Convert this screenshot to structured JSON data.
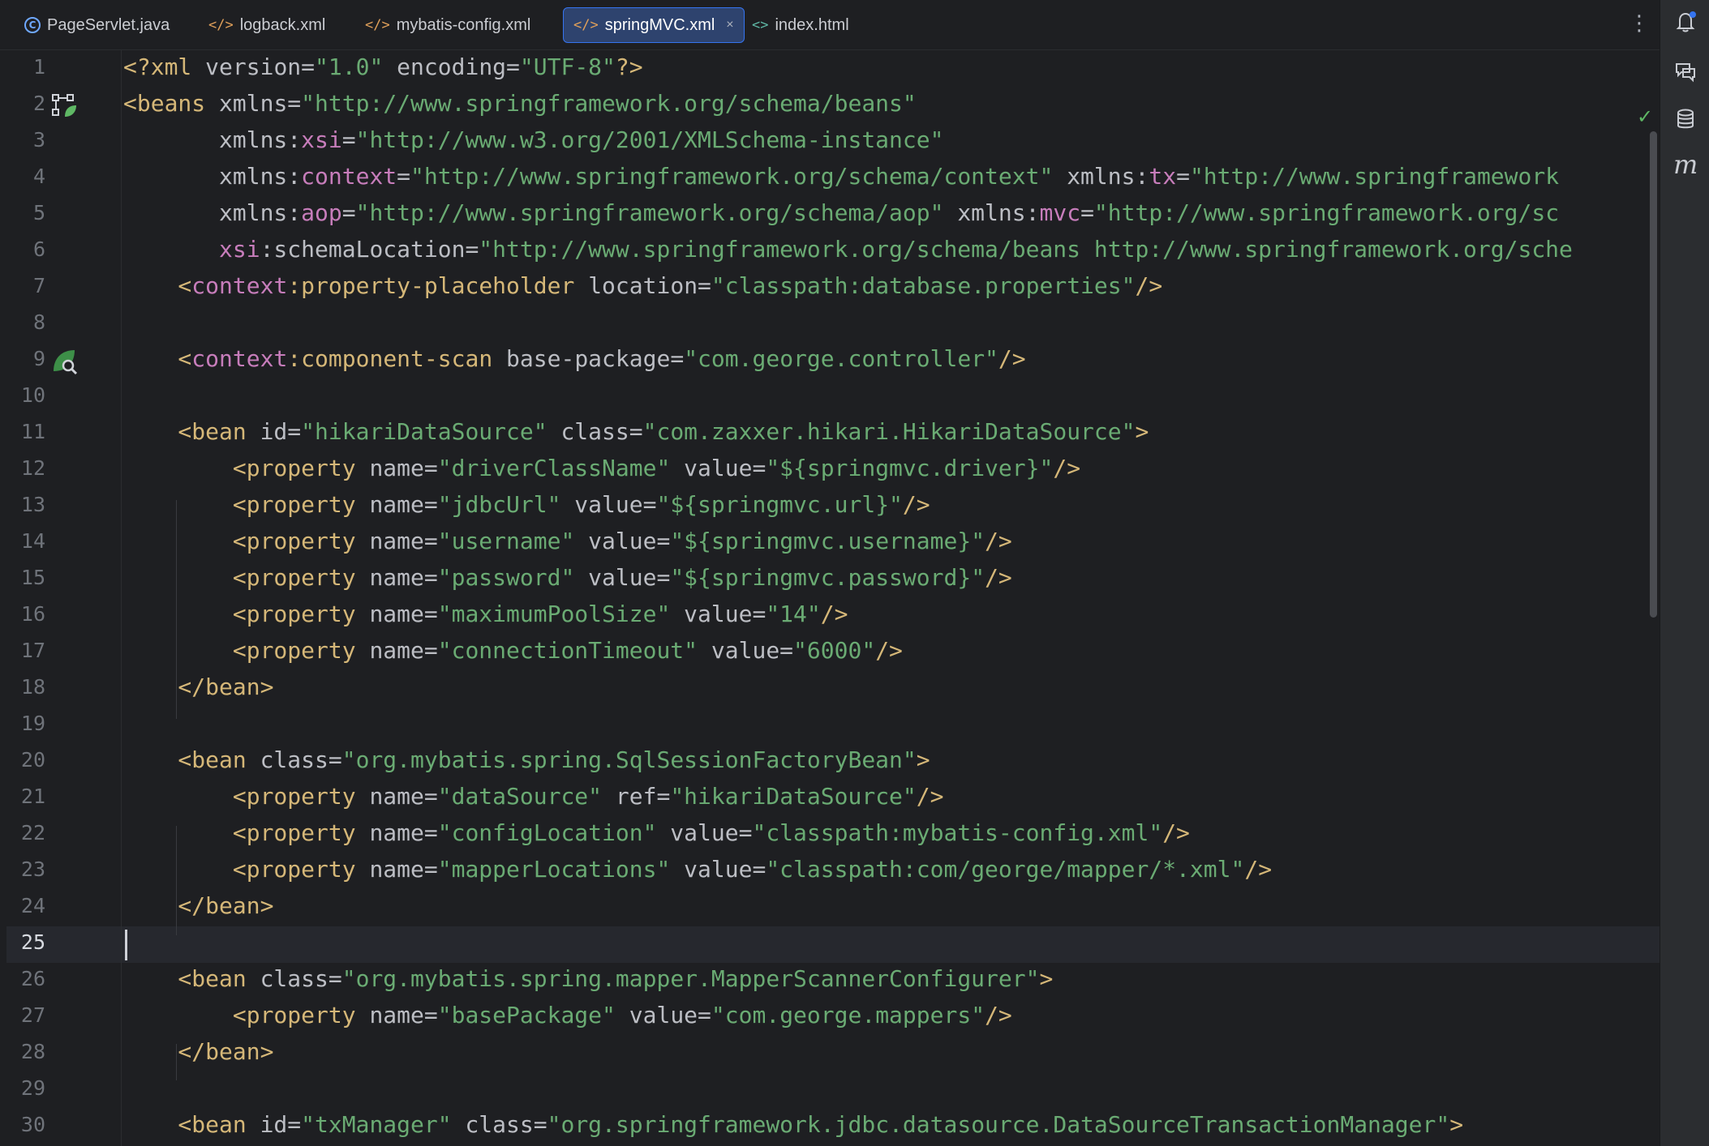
{
  "tabs": [
    {
      "label": "PageServlet.java",
      "icon": "java-class-icon",
      "active": false
    },
    {
      "label": "logback.xml",
      "icon": "xml-icon",
      "active": false
    },
    {
      "label": "mybatis-config.xml",
      "icon": "xml-icon",
      "active": false
    },
    {
      "label": "springMVC.xml",
      "icon": "xml-icon",
      "active": true
    },
    {
      "label": "index.html",
      "icon": "html-icon",
      "active": false
    }
  ],
  "tab_menu_glyph": "⋮",
  "tab_close_glyph": "×",
  "current_line": 25,
  "line_numbers": [
    "1",
    "2",
    "3",
    "4",
    "5",
    "6",
    "7",
    "8",
    "9",
    "10",
    "11",
    "12",
    "13",
    "14",
    "15",
    "16",
    "17",
    "18",
    "19",
    "20",
    "21",
    "22",
    "23",
    "24",
    "25",
    "26",
    "27",
    "28",
    "29",
    "30"
  ],
  "code_lines": [
    [
      [
        "t",
        "<?xml "
      ],
      [
        "a",
        "version="
      ],
      [
        "s",
        "\"1.0\""
      ],
      [
        "a",
        " encoding="
      ],
      [
        "s",
        "\"UTF-8\""
      ],
      [
        "t",
        "?>"
      ]
    ],
    [
      [
        "t",
        "<beans "
      ],
      [
        "a",
        "xmlns="
      ],
      [
        "s",
        "\"http://www.springframework.org/schema/beans\""
      ]
    ],
    [
      [
        "a",
        "       xmlns:"
      ],
      [
        "p",
        "xsi"
      ],
      [
        "a",
        "="
      ],
      [
        "s",
        "\"http://www.w3.org/2001/XMLSchema-instance\""
      ]
    ],
    [
      [
        "a",
        "       xmlns:"
      ],
      [
        "p",
        "context"
      ],
      [
        "a",
        "="
      ],
      [
        "s",
        "\"http://www.springframework.org/schema/context\""
      ],
      [
        "a",
        " xmlns:"
      ],
      [
        "p",
        "tx"
      ],
      [
        "a",
        "="
      ],
      [
        "s",
        "\"http://www.springframework"
      ]
    ],
    [
      [
        "a",
        "       xmlns:"
      ],
      [
        "p",
        "aop"
      ],
      [
        "a",
        "="
      ],
      [
        "s",
        "\"http://www.springframework.org/schema/aop\""
      ],
      [
        "a",
        " xmlns:"
      ],
      [
        "p",
        "mvc"
      ],
      [
        "a",
        "="
      ],
      [
        "s",
        "\"http://www.springframework.org/sc"
      ]
    ],
    [
      [
        "p",
        "       xsi"
      ],
      [
        "a",
        ":schemaLocation="
      ],
      [
        "s",
        "\"http://www.springframework.org/schema/beans http://www.springframework.org/sche"
      ]
    ],
    [
      [
        "t",
        "    <"
      ],
      [
        "p",
        "context"
      ],
      [
        "t",
        ":property-placeholder "
      ],
      [
        "a",
        "location="
      ],
      [
        "s",
        "\"classpath:database.properties\""
      ],
      [
        "t",
        "/>"
      ]
    ],
    [],
    [
      [
        "t",
        "    <"
      ],
      [
        "p",
        "context"
      ],
      [
        "t",
        ":component-scan "
      ],
      [
        "a",
        "base-package="
      ],
      [
        "s",
        "\"com.george.controller\""
      ],
      [
        "t",
        "/>"
      ]
    ],
    [],
    [
      [
        "t",
        "    <bean "
      ],
      [
        "a",
        "id="
      ],
      [
        "s",
        "\"hikariDataSource\""
      ],
      [
        "a",
        " class="
      ],
      [
        "s",
        "\"com.zaxxer.hikari.HikariDataSource\""
      ],
      [
        "t",
        ">"
      ]
    ],
    [
      [
        "t",
        "        <property "
      ],
      [
        "a",
        "name="
      ],
      [
        "s",
        "\"driverClassName\""
      ],
      [
        "a",
        " value="
      ],
      [
        "s",
        "\"${springmvc.driver}\""
      ],
      [
        "t",
        "/>"
      ]
    ],
    [
      [
        "t",
        "        <property "
      ],
      [
        "a",
        "name="
      ],
      [
        "s",
        "\"jdbcUrl\""
      ],
      [
        "a",
        " value="
      ],
      [
        "s",
        "\"${springmvc.url}\""
      ],
      [
        "t",
        "/>"
      ]
    ],
    [
      [
        "t",
        "        <property "
      ],
      [
        "a",
        "name="
      ],
      [
        "s",
        "\"username\""
      ],
      [
        "a",
        " value="
      ],
      [
        "s",
        "\"${springmvc.username}\""
      ],
      [
        "t",
        "/>"
      ]
    ],
    [
      [
        "t",
        "        <property "
      ],
      [
        "a",
        "name="
      ],
      [
        "s",
        "\"password\""
      ],
      [
        "a",
        " value="
      ],
      [
        "s",
        "\"${springmvc.password}\""
      ],
      [
        "t",
        "/>"
      ]
    ],
    [
      [
        "t",
        "        <property "
      ],
      [
        "a",
        "name="
      ],
      [
        "s",
        "\"maximumPoolSize\""
      ],
      [
        "a",
        " value="
      ],
      [
        "s",
        "\"14\""
      ],
      [
        "t",
        "/>"
      ]
    ],
    [
      [
        "t",
        "        <property "
      ],
      [
        "a",
        "name="
      ],
      [
        "s",
        "\"connectionTimeout\""
      ],
      [
        "a",
        " value="
      ],
      [
        "s",
        "\"6000\""
      ],
      [
        "t",
        "/>"
      ]
    ],
    [
      [
        "t",
        "    </bean>"
      ]
    ],
    [],
    [
      [
        "t",
        "    <bean "
      ],
      [
        "a",
        "class="
      ],
      [
        "s",
        "\"org.mybatis.spring.SqlSessionFactoryBean\""
      ],
      [
        "t",
        ">"
      ]
    ],
    [
      [
        "t",
        "        <property "
      ],
      [
        "a",
        "name="
      ],
      [
        "s",
        "\"dataSource\""
      ],
      [
        "a",
        " ref="
      ],
      [
        "s",
        "\"hikariDataSource\""
      ],
      [
        "t",
        "/>"
      ]
    ],
    [
      [
        "t",
        "        <property "
      ],
      [
        "a",
        "name="
      ],
      [
        "s",
        "\"configLocation\""
      ],
      [
        "a",
        " value="
      ],
      [
        "s",
        "\"classpath:mybatis-config.xml\""
      ],
      [
        "t",
        "/>"
      ]
    ],
    [
      [
        "t",
        "        <property "
      ],
      [
        "a",
        "name="
      ],
      [
        "s",
        "\"mapperLocations\""
      ],
      [
        "a",
        " value="
      ],
      [
        "s",
        "\"classpath:com/george/mapper/*.xml\""
      ],
      [
        "t",
        "/>"
      ]
    ],
    [
      [
        "t",
        "    </bean>"
      ]
    ],
    [],
    [
      [
        "t",
        "    <bean "
      ],
      [
        "a",
        "class="
      ],
      [
        "s",
        "\"org.mybatis.spring.mapper.MapperScannerConfigurer\""
      ],
      [
        "t",
        ">"
      ]
    ],
    [
      [
        "t",
        "        <property "
      ],
      [
        "a",
        "name="
      ],
      [
        "s",
        "\"basePackage\""
      ],
      [
        "a",
        " value="
      ],
      [
        "s",
        "\"com.george.mappers\""
      ],
      [
        "t",
        "/>"
      ]
    ],
    [
      [
        "t",
        "    </bean>"
      ]
    ],
    [],
    [
      [
        "t",
        "    <bean "
      ],
      [
        "a",
        "id="
      ],
      [
        "s",
        "\"txManager\""
      ],
      [
        "a",
        " class="
      ],
      [
        "s",
        "\"org.springframework.jdbc.datasource.DataSourceTransactionManager\""
      ],
      [
        "t",
        ">"
      ]
    ]
  ],
  "gutter_icons": [
    {
      "line": 2,
      "icon": "bean-config-icon"
    },
    {
      "line": 9,
      "icon": "component-scan-icon"
    }
  ],
  "inspection_glyph": "✓",
  "right_toolbar": [
    {
      "icon": "notifications-icon"
    },
    {
      "icon": "ai-assistant-icon"
    },
    {
      "icon": "database-icon"
    },
    {
      "icon": "maven-icon",
      "glyph": "m"
    }
  ],
  "colors": {
    "background": "#1e1f22",
    "tag": "#d5b778",
    "namespace_prefix": "#c77dbb",
    "attribute": "#bcbec4",
    "string": "#6aab73",
    "active_tab": "#2e436e",
    "accent": "#3574f0"
  }
}
